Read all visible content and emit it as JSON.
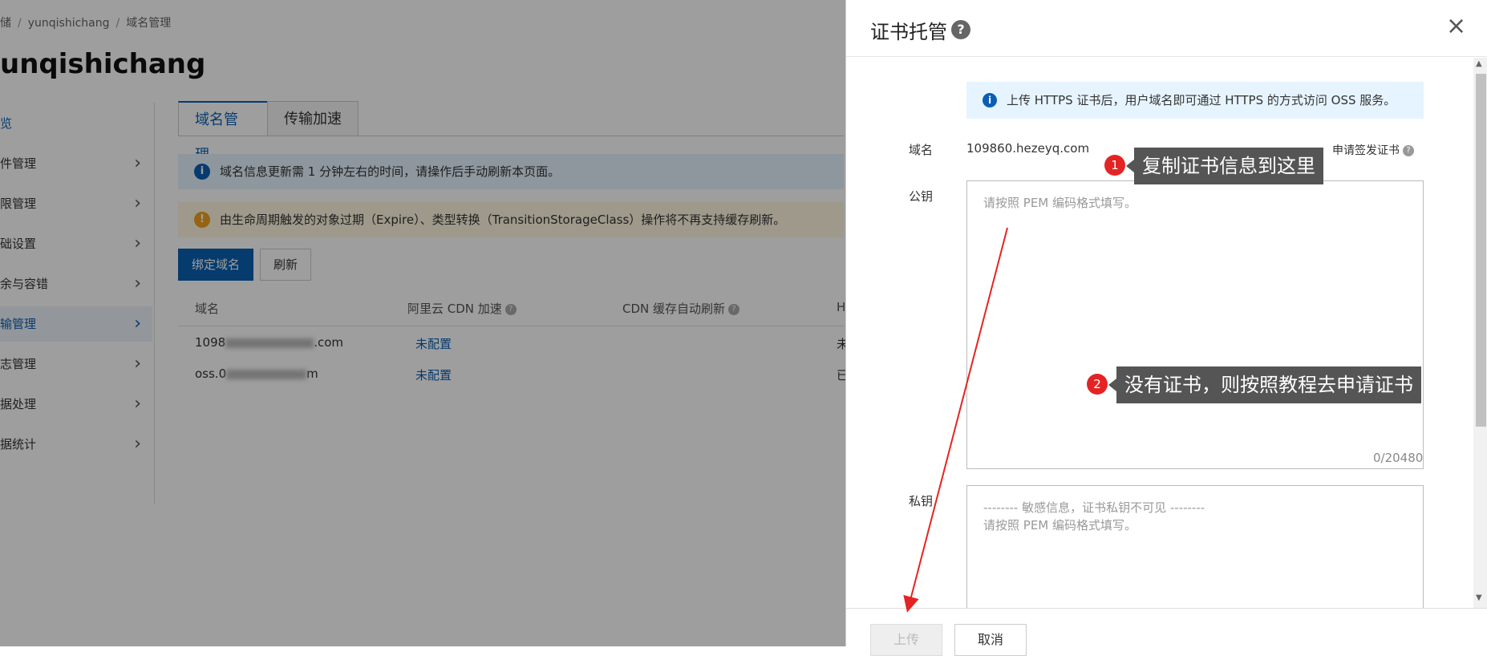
{
  "breadcrumb": {
    "items": [
      "存储",
      "yunqishichang",
      "域名管理"
    ]
  },
  "bucket_title": "unqishichang",
  "sidebar": {
    "items": [
      {
        "label": "览"
      },
      {
        "label": "件管理"
      },
      {
        "label": "限管理"
      },
      {
        "label": "础设置"
      },
      {
        "label": "余与容错"
      },
      {
        "label": "输管理"
      },
      {
        "label": "志管理"
      },
      {
        "label": "据处理"
      },
      {
        "label": "据统计"
      }
    ]
  },
  "tabs": {
    "domain": "域名管理",
    "transfer": "传输加速"
  },
  "notices": {
    "info": "域名信息更新需 1 分钟左右的时间，请操作后手动刷新本页面。",
    "warning": "由生命周期触发的对象过期（Expire）、类型转换（TransitionStorageClass）操作将不再支持缓存刷新。"
  },
  "toolbar": {
    "bind_label": "绑定域名",
    "refresh_label": "刷新"
  },
  "table": {
    "headers": {
      "domain": "域名",
      "cdn": "阿里云 CDN 加速",
      "auto_refresh": "CDN 缓存自动刷新",
      "h": "H"
    },
    "rows": [
      {
        "domain_start": "1098",
        "domain_end": ".com",
        "cdn": "未配置",
        "tail": "未"
      },
      {
        "domain_start": "oss.0",
        "domain_end": "m",
        "cdn": "未配置",
        "tail": "已"
      }
    ]
  },
  "drawer": {
    "title": "证书托管",
    "help_icon": "?",
    "close_icon": "×",
    "info": "上传 HTTPS 证书后，用户域名即可通过 HTTPS 的方式访问 OSS 服务。",
    "domain_label": "域名",
    "domain_value": "109860.hezeyq.com",
    "apply_label": "申请签发证书",
    "pubkey_label": "公钥",
    "pubkey_placeholder": "请按照 PEM 编码格式填写。",
    "pubkey_count": "0/20480",
    "privkey_label": "私钥",
    "privkey_line1": "-------- 敏感信息，证书私钥不可见 --------",
    "privkey_line2": "请按照 PEM 编码格式填写。",
    "upload_label": "上传",
    "cancel_label": "取消"
  },
  "annotations": {
    "badge1": "1",
    "callout1": "复制证书信息到这里",
    "badge2": "2",
    "callout2": "没有证书，则按照教程去申请证书",
    "arrow_color": "#e42424"
  },
  "colors": {
    "brand": "#0a5fb2",
    "info_bg": "#e6f4ff",
    "badge": "#e42424",
    "callout_bg": "#555555"
  }
}
